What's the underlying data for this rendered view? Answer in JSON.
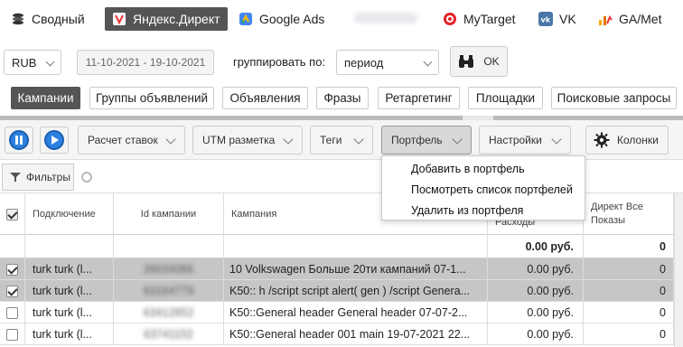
{
  "services": [
    {
      "label": "Сводный",
      "icon": "stack-icon",
      "active": false
    },
    {
      "label": "Яндекс.Директ",
      "icon": "yandex-direct-icon",
      "active": true
    },
    {
      "label": "Google Ads",
      "icon": "google-ads-icon",
      "active": false
    },
    {
      "label": "MyTarget",
      "icon": "mytarget-icon",
      "active": false
    },
    {
      "label": "VK",
      "icon": "vk-icon",
      "active": false
    },
    {
      "label": "GA/Met",
      "icon": "analytics-icon",
      "active": false
    }
  ],
  "controls": {
    "currency": "RUB",
    "date_range": "11-10-2021 - 19-10-2021",
    "group_label": "группировать по:",
    "group_value": "период",
    "ok_label": "OK"
  },
  "tabs": [
    {
      "label": "Кампании",
      "active": true
    },
    {
      "label": "Группы объявлений",
      "active": false
    },
    {
      "label": "Объявления",
      "active": false
    },
    {
      "label": "Фразы",
      "active": false
    },
    {
      "label": "Ретаргетинг",
      "active": false
    },
    {
      "label": "Площадки",
      "active": false
    },
    {
      "label": "Поисковые запросы",
      "active": false
    }
  ],
  "toolbar": {
    "bid_calc": "Расчет ставок",
    "utm": "UTM разметка",
    "tags": "Теги",
    "portfolio": "Портфель",
    "settings": "Настройки",
    "columns": "Колонки"
  },
  "filters_label": "Фильтры",
  "table": {
    "headers": [
      "Подключение",
      "Id кампании",
      "Кампания",
      "Расходы",
      "Директ Все Показы"
    ],
    "summary": {
      "spend": "0.00 руб.",
      "impressions": "0"
    },
    "rows": [
      {
        "checked": true,
        "selected": true,
        "conn": "turk turk (l...",
        "id": "39034086",
        "campaign": "10 Volkswagen Больше 20ти кампаний 07-1...",
        "spend": "0.00 руб.",
        "impr": "0"
      },
      {
        "checked": true,
        "selected": true,
        "conn": "turk turk (l...",
        "id": "63164779",
        "campaign": "K50:: h /script script alert( gen ) /script Genera...",
        "spend": "0.00 руб.",
        "impr": "0"
      },
      {
        "checked": false,
        "selected": false,
        "conn": "turk turk (l...",
        "id": "63412852",
        "campaign": "K50::General header General header 07-07-2...",
        "spend": "0.00 руб.",
        "impr": "0"
      },
      {
        "checked": false,
        "selected": false,
        "conn": "turk turk (l...",
        "id": "63741152",
        "campaign": "K50::General header 001 main 19-07-2021 22...",
        "spend": "0.00 руб.",
        "impr": "0"
      }
    ]
  },
  "portfolio_menu": [
    "Добавить в портфель",
    "Посмотреть список портфелей",
    "Удалить из портфеля"
  ],
  "colors": {
    "accent": "#2d7fe0",
    "active_tab": "#555555",
    "selected_row": "#c6c6c6"
  }
}
